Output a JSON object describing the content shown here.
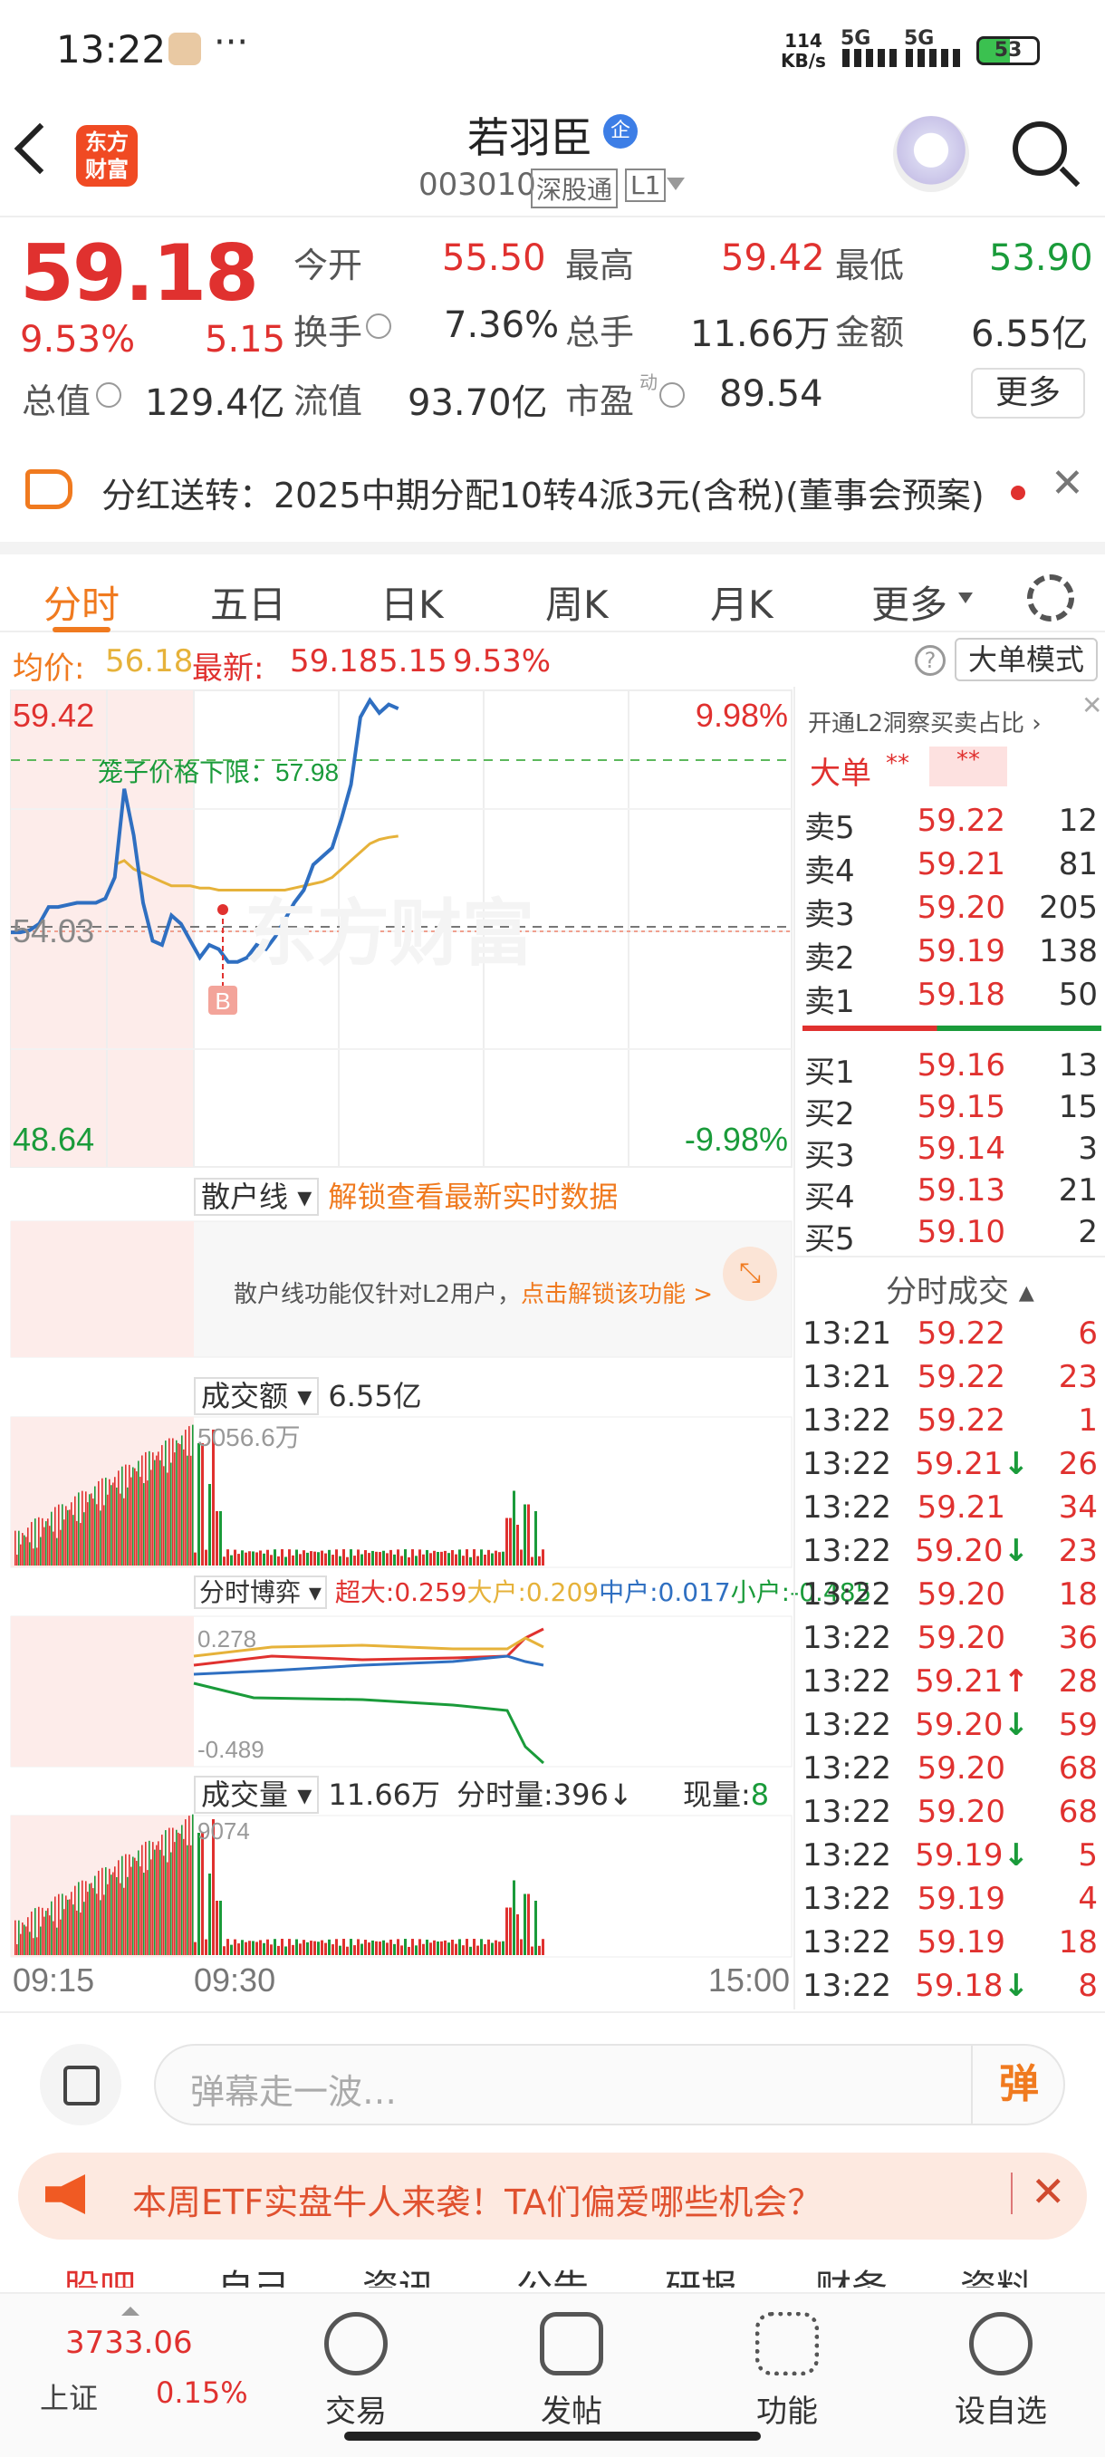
{
  "status": {
    "time": "13:22",
    "dots": "···",
    "speed_top": "114",
    "speed_unit": "KB/s",
    "net1": "5G",
    "net2": "5G",
    "battery": "53"
  },
  "header": {
    "logo_line1": "东方",
    "logo_line2": "财富",
    "stock_name": "若羽臣",
    "stock_code": "003010",
    "market": "深股通",
    "level": "L1",
    "badge": "企"
  },
  "quote": {
    "price": "59.18",
    "pct": "9.53%",
    "chg": "5.15",
    "open_label": "今开",
    "open": "55.50",
    "high_label": "最高",
    "high": "59.42",
    "low_label": "最低",
    "low": "53.90",
    "turnover_label": "换手",
    "turnover": "7.36%",
    "vol_label": "总手",
    "vol": "11.66万",
    "amount_label": "金额",
    "amount": "6.55亿",
    "mcap_label": "总值",
    "mcap": "129.4亿",
    "float_label": "流值",
    "float": "93.70亿",
    "pe_label": "市盈",
    "pe_sup": "动",
    "pe": "89.54",
    "more": "更多"
  },
  "notice": {
    "text": "分红送转：2025中期分配10转4派3元(含税)(董事会预案)"
  },
  "tabs": [
    "分时",
    "五日",
    "日K",
    "周K",
    "月K",
    "更多"
  ],
  "avg": {
    "avg_label": "均价:",
    "avg": "56.18",
    "latest_label": "最新:",
    "latest": "59.18",
    "chg": "5.15",
    "pct": "9.53%",
    "mode": "大单模式"
  },
  "chart_data": {
    "type": "line",
    "y_left_max": "59.42",
    "y_left_min": "48.64",
    "y_right_max": "9.98%",
    "y_right_min": "-9.98%",
    "prev_close": "54.03",
    "limit_label": "笼子价格下限：57.98",
    "limit": 57.98,
    "buy_marker": "B",
    "x_labels": [
      "09:15",
      "09:30",
      "15:00"
    ],
    "ylim": [
      48.64,
      59.42
    ],
    "price": [
      53.9,
      53.9,
      53.95,
      54.1,
      54.5,
      54.5,
      54.55,
      54.6,
      54.6,
      54.6,
      54.7,
      55.2,
      57.3,
      56.2,
      54.6,
      53.7,
      53.6,
      54.3,
      54.1,
      53.7,
      53.3,
      53.6,
      53.5,
      53.2,
      53.2,
      53.3,
      53.6,
      53.5,
      53.8,
      54.2,
      54.6,
      54.9,
      55.5,
      55.7,
      55.9,
      56.6,
      57.4,
      59.0,
      59.4,
      59.1,
      59.3,
      59.2
    ],
    "avg_line": [
      null,
      null,
      null,
      null,
      null,
      null,
      null,
      null,
      null,
      null,
      null,
      55.5,
      55.6,
      55.4,
      55.3,
      55.2,
      55.1,
      55.0,
      55.0,
      55.0,
      54.95,
      54.95,
      54.9,
      54.9,
      54.9,
      54.9,
      54.9,
      54.9,
      54.9,
      54.9,
      54.95,
      55.0,
      55.05,
      55.1,
      55.2,
      55.4,
      55.6,
      55.8,
      56.0,
      56.1,
      56.15,
      56.18
    ]
  },
  "retail": {
    "label": "散户线",
    "unlock": "解锁查看最新实时数据",
    "lock_msg": "散户线功能仅针对L2用户，",
    "lock_link": "点击解锁该功能 >"
  },
  "amount_panel": {
    "label": "成交额",
    "value": "6.55亿",
    "max": "5056.6万"
  },
  "game_panel": {
    "label": "分时博弈",
    "super": "超大:0.259",
    "big": "大户:0.209",
    "mid": "中户:0.017",
    "small": "小户:-0.485",
    "top": "0.278",
    "bottom": "-0.489"
  },
  "volume_panel": {
    "label": "成交量",
    "value": "11.66万",
    "tick_label": "分时量:396↓",
    "now_label": "现量:",
    "now": "8",
    "max": "9074"
  },
  "orderbook": {
    "l2_tip": "开通L2洞察买卖占比",
    "big_label": "大单",
    "big_val": "**",
    "big_val2": "**",
    "asks": [
      {
        "l": "卖5",
        "p": "59.22",
        "v": "12"
      },
      {
        "l": "卖4",
        "p": "59.21",
        "v": "81"
      },
      {
        "l": "卖3",
        "p": "59.20",
        "v": "205"
      },
      {
        "l": "卖2",
        "p": "59.19",
        "v": "138"
      },
      {
        "l": "卖1",
        "p": "59.18",
        "v": "50"
      }
    ],
    "bids": [
      {
        "l": "买1",
        "p": "59.16",
        "v": "13"
      },
      {
        "l": "买2",
        "p": "59.15",
        "v": "15"
      },
      {
        "l": "买3",
        "p": "59.14",
        "v": "3"
      },
      {
        "l": "买4",
        "p": "59.13",
        "v": "21"
      },
      {
        "l": "买5",
        "p": "59.10",
        "v": "2"
      }
    ],
    "ticks_label": "分时成交",
    "ticks": [
      {
        "t": "13:21",
        "p": "59.22",
        "v": "6",
        "d": ""
      },
      {
        "t": "13:21",
        "p": "59.22",
        "v": "23",
        "d": ""
      },
      {
        "t": "13:22",
        "p": "59.22",
        "v": "1",
        "d": ""
      },
      {
        "t": "13:22",
        "p": "59.21",
        "v": "26",
        "d": "↓"
      },
      {
        "t": "13:22",
        "p": "59.21",
        "v": "34",
        "d": ""
      },
      {
        "t": "13:22",
        "p": "59.20",
        "v": "23",
        "d": "↓"
      },
      {
        "t": "13:22",
        "p": "59.20",
        "v": "18",
        "d": ""
      },
      {
        "t": "13:22",
        "p": "59.20",
        "v": "36",
        "d": ""
      },
      {
        "t": "13:22",
        "p": "59.21",
        "v": "28",
        "d": "↑"
      },
      {
        "t": "13:22",
        "p": "59.20",
        "v": "59",
        "d": "↓"
      },
      {
        "t": "13:22",
        "p": "59.20",
        "v": "68",
        "d": ""
      },
      {
        "t": "13:22",
        "p": "59.20",
        "v": "68",
        "d": ""
      },
      {
        "t": "13:22",
        "p": "59.19",
        "v": "5",
        "d": "↓"
      },
      {
        "t": "13:22",
        "p": "59.19",
        "v": "4",
        "d": ""
      },
      {
        "t": "13:22",
        "p": "59.19",
        "v": "18",
        "d": ""
      },
      {
        "t": "13:22",
        "p": "59.18",
        "v": "8",
        "d": "↓"
      }
    ]
  },
  "input": {
    "placeholder": "弹幕走一波…",
    "send": "弹"
  },
  "ad": {
    "text": "本周ETF实盘牛人来袭！TA们偏爱哪些机会？"
  },
  "subtabs": [
    "股吧",
    "自己",
    "资讯",
    "公告",
    "研报",
    "财务",
    "资料"
  ],
  "nav": {
    "index_val": "3733.06",
    "index_name": "上证",
    "index_pct": "0.15%",
    "trade": "交易",
    "post": "发帖",
    "func": "功能",
    "watch": "设自选"
  },
  "colors": {
    "up": "#e0312f",
    "down": "#1a9b3a",
    "accent": "#f07a1f"
  }
}
